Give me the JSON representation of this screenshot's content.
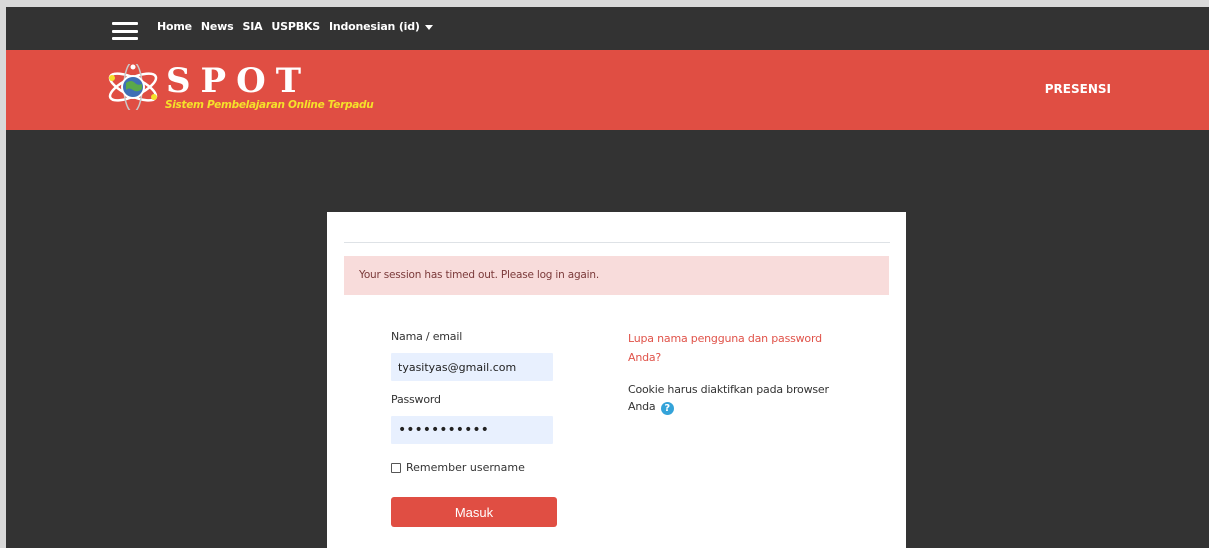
{
  "topnav": {
    "menu_icon": "hamburger-icon",
    "links": [
      "Home",
      "News",
      "SIA",
      "USPBKS"
    ],
    "language": "Indonesian (id)"
  },
  "brand": {
    "logo_icon": "atom-globe-logo",
    "title": "SPOT",
    "subtitle": "Sistem Pembelajaran Online Terpadu",
    "right_link": "PRESENSI",
    "color": "#e04e43",
    "subtitle_color": "#f5e12a"
  },
  "login": {
    "alert": "Your session has timed out. Please log in again.",
    "username_label": "Nama / email",
    "username_value": "tyasityas@gmail.com",
    "password_label": "Password",
    "password_value": "•••••••••••",
    "remember_label": "Remember username",
    "remember_checked": false,
    "submit_label": "Masuk",
    "forgot_link": "Lupa nama pengguna dan password Anda?",
    "cookie_text": "Cookie harus diaktifkan pada browser Anda",
    "help_icon": "question-circle-icon"
  }
}
